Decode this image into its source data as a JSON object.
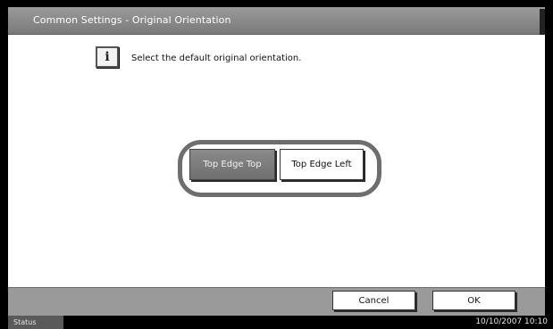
{
  "window": {
    "title": "Common Settings - Original Orientation"
  },
  "info": {
    "icon": "info-icon",
    "icon_glyph": "i",
    "message": "Select the default original orientation."
  },
  "options": {
    "top_edge_top": "Top Edge Top",
    "top_edge_left": "Top Edge Left",
    "selected": "Top Edge Top"
  },
  "footer": {
    "cancel_label": "Cancel",
    "ok_label": "OK"
  },
  "status": {
    "tab_label": "Status",
    "datetime": "10/10/2007   10:10"
  }
}
